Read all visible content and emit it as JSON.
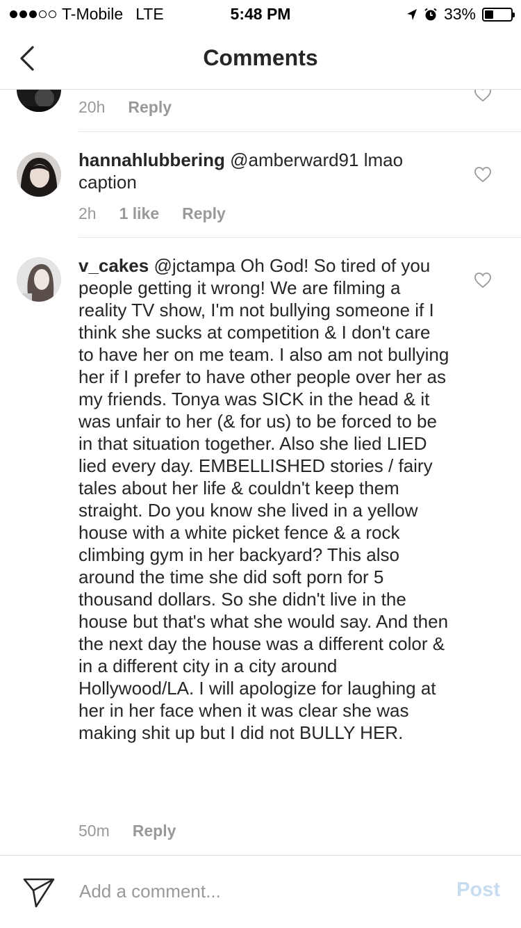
{
  "status_bar": {
    "carrier": "T-Mobile",
    "network": "LTE",
    "time": "5:48 PM",
    "battery_percent_label": "33%",
    "battery_level": 0.33
  },
  "nav": {
    "title": "Comments"
  },
  "comments": [
    {
      "username": "",
      "text": "",
      "time": "20h",
      "likes": "",
      "reply": "Reply"
    },
    {
      "username": "hannahlubbering",
      "text": " @amberward91 lmao caption",
      "time": "2h",
      "likes": "1 like",
      "reply": "Reply"
    },
    {
      "username": "v_cakes",
      "text": " @jctampa Oh God!  So tired of you people getting it wrong!  We are filming a reality TV show, I'm not bullying someone if I think she sucks at competition & I don't care to have her on me team. I also am not bullying her if I prefer to have other people over her as my friends. Tonya was SICK in the head & it was unfair to her (& for us) to be forced to be in that situation together. Also she lied LIED lied every day. EMBELLISHED stories / fairy tales about her life & couldn't keep them straight. Do you know she lived in a yellow house with a white picket fence & a rock climbing gym in her backyard?  This also around the time she did soft porn for 5 thousand dollars.  So she didn't live in the house but that's what she would say. And then the next day the house was a different color & in a different city in a city around Hollywood/LA.  I will apologize for laughing at her in her face when it was clear she was making shit up but I did not BULLY HER.",
      "time": "50m",
      "likes": "",
      "reply": "Reply"
    }
  ],
  "composer": {
    "placeholder": "Add a comment...",
    "post_label": "Post"
  }
}
